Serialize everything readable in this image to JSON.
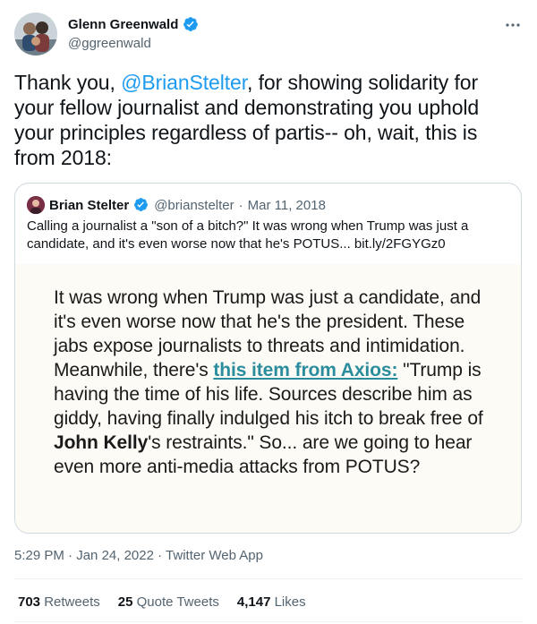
{
  "author": {
    "name": "Glenn Greenwald",
    "handle": "@ggreenwald",
    "verified": true
  },
  "tweet": {
    "text_before": "Thank you, ",
    "mention": "@BrianStelter",
    "text_after": ", for showing solidarity for your fellow journalist and demonstrating you uphold your principles regardless of partis-- oh, wait, this is from 2018:"
  },
  "quote": {
    "name": "Brian Stelter",
    "handle": "@brianstelter",
    "separator": "·",
    "date": "Mar 11, 2018",
    "text": "Calling a journalist a \"son of a bitch?\" It was wrong when Trump was just a candidate, and it's even worse now that he's POTUS... bit.ly/2FGYGz0",
    "image_text_1": "It was wrong when Trump was just a candidate, and it's even worse now that he's the president. These jabs expose journalists to threats and intimidation. Meanwhile, there's ",
    "image_link": "this item from Axios:",
    "image_text_2": " \"Trump is having the time of his life. Sources describe him as giddy, having finally indulged his itch to break free of ",
    "image_bold": "John Kelly",
    "image_text_3": "'s restraints.\" So... are we going to hear even more anti-media attacks from POTUS?"
  },
  "meta": {
    "time": "5:29 PM",
    "separator": "·",
    "date": "Jan 24, 2022",
    "source": "Twitter Web App"
  },
  "stats": {
    "retweets_count": "703",
    "retweets_label": "Retweets",
    "quotes_count": "25",
    "quotes_label": "Quote Tweets",
    "likes_count": "4,147",
    "likes_label": "Likes"
  },
  "colors": {
    "accent": "#1d9bf0",
    "secondary_text": "#536471",
    "border": "#cfd9de"
  },
  "icons": {
    "verified": "verified-badge-icon",
    "more": "more-options-icon"
  }
}
